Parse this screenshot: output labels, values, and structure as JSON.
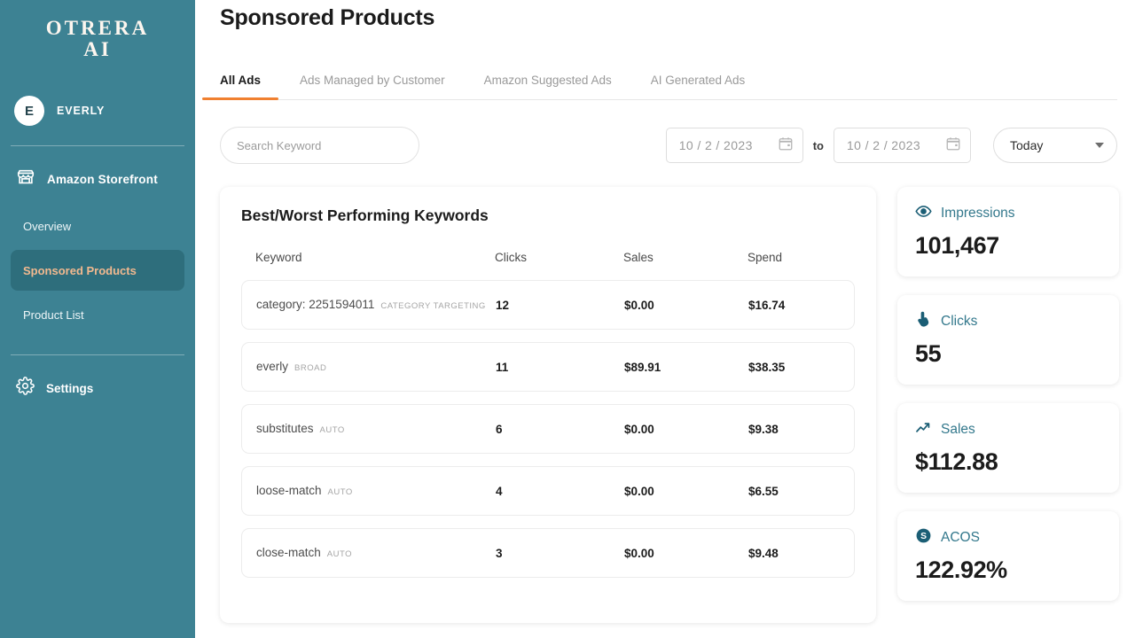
{
  "sidebar": {
    "logo_line1": "OTRERA",
    "logo_line2": "AI",
    "account": {
      "initial": "E",
      "name": "EVERLY"
    },
    "main_nav": {
      "icon": "storefront-icon",
      "label": "Amazon Storefront"
    },
    "items": [
      {
        "label": "Overview",
        "active": false
      },
      {
        "label": "Sponsored Products",
        "active": true
      },
      {
        "label": "Product List",
        "active": false
      }
    ],
    "settings": {
      "icon": "gear-icon",
      "label": "Settings"
    },
    "colors": {
      "bg": "#3d8293",
      "active_bg": "#2e6e7c",
      "active_text": "#f2b98f"
    }
  },
  "header": {
    "title": "Sponsored Products"
  },
  "tabs": [
    {
      "label": "All Ads",
      "active": true
    },
    {
      "label": "Ads Managed by Customer",
      "active": false
    },
    {
      "label": "Amazon Suggested Ads",
      "active": false
    },
    {
      "label": "AI Generated Ads",
      "active": false
    }
  ],
  "accent_color": "#f08030",
  "filters": {
    "search_placeholder": "Search Keyword",
    "date_from": "10 / 2 / 2023",
    "date_to": "10 / 2 / 2023",
    "to_label": "to",
    "range_select": "Today"
  },
  "keywords_panel": {
    "title": "Best/Worst Performing Keywords",
    "columns": [
      "Keyword",
      "Clicks",
      "Sales",
      "Spend"
    ],
    "rows": [
      {
        "keyword": "category: 2251594011",
        "match_type": "CATEGORY TARGETING",
        "clicks": "12",
        "sales": "$0.00",
        "spend": "$16.74"
      },
      {
        "keyword": "everly",
        "match_type": "BROAD",
        "clicks": "11",
        "sales": "$89.91",
        "spend": "$38.35"
      },
      {
        "keyword": "substitutes",
        "match_type": "AUTO",
        "clicks": "6",
        "sales": "$0.00",
        "spend": "$9.38"
      },
      {
        "keyword": "loose-match",
        "match_type": "AUTO",
        "clicks": "4",
        "sales": "$0.00",
        "spend": "$6.55"
      },
      {
        "keyword": "close-match",
        "match_type": "AUTO",
        "clicks": "3",
        "sales": "$0.00",
        "spend": "$9.48"
      }
    ]
  },
  "metrics": [
    {
      "icon": "eye-icon",
      "label": "Impressions",
      "value": "101,467"
    },
    {
      "icon": "click-hand-icon",
      "label": "Clicks",
      "value": "55"
    },
    {
      "icon": "trend-up-icon",
      "label": "Sales",
      "value": "$112.88"
    },
    {
      "icon": "dollar-coin-icon",
      "label": "ACOS",
      "value": "122.92%"
    }
  ]
}
